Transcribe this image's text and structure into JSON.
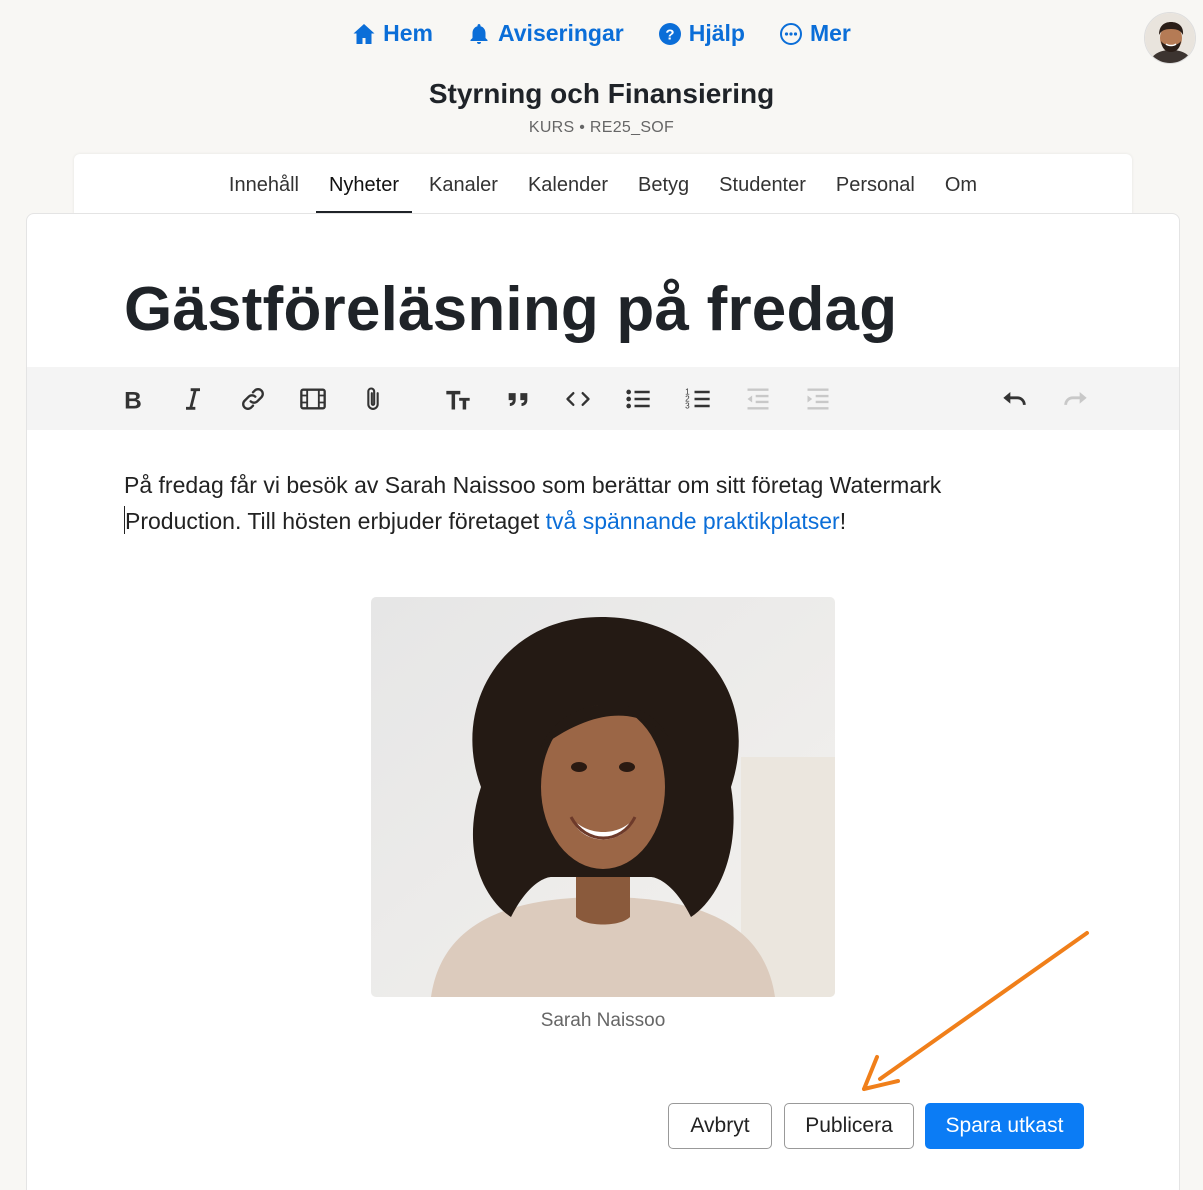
{
  "topnav": {
    "items": [
      {
        "label": "Hem",
        "icon": "home-icon"
      },
      {
        "label": "Aviseringar",
        "icon": "bell-icon"
      },
      {
        "label": "Hjälp",
        "icon": "help-circle-icon"
      },
      {
        "label": "Mer",
        "icon": "more-circle-icon"
      }
    ]
  },
  "course": {
    "title": "Styrning och Finansiering",
    "meta": "KURS • RE25_SOF"
  },
  "tabs": [
    "Innehåll",
    "Nyheter",
    "Kanaler",
    "Kalender",
    "Betyg",
    "Studenter",
    "Personal",
    "Om"
  ],
  "active_tab": "Nyheter",
  "post": {
    "title": "Gästföreläsning på fredag",
    "body_before": "På fredag får vi besök av Sarah Naissoo som berättar om sitt företag Watermark ",
    "body_line2_before": "Production. Till hösten erbjuder företaget ",
    "link_text": "två spännande praktikplatser",
    "body_after": "!",
    "image_caption": "Sarah Naissoo"
  },
  "toolbar": [
    "bold-icon",
    "italic-icon",
    "link-icon",
    "video-icon",
    "attachment-icon",
    "text-size-icon",
    "quote-icon",
    "code-icon",
    "bullet-list-icon",
    "numbered-list-icon",
    "outdent-icon",
    "indent-icon",
    "undo-icon",
    "redo-icon"
  ],
  "buttons": {
    "cancel": "Avbryt",
    "publish": "Publicera",
    "save_draft": "Spara utkast"
  },
  "colors": {
    "accent": "#0b6ed8",
    "primary_button": "#0b7cf5",
    "annotation_arrow": "#f07f1a"
  }
}
